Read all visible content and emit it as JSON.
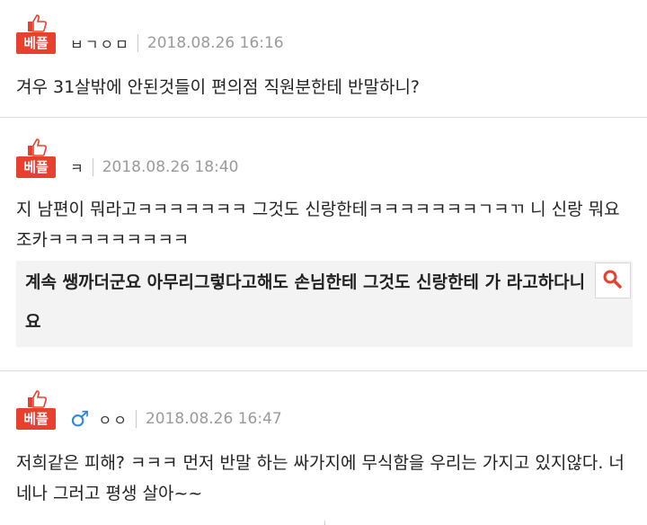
{
  "comments": [
    {
      "badge": "베플",
      "nickname": "ㅂㄱㅇㅁ",
      "date": "2018.08.26 16:16",
      "text": "겨우 31살밖에 안된것들이 편의점 직원분한테 반말하니?"
    },
    {
      "badge": "베플",
      "nickname": "ㅋ",
      "date": "2018.08.26 18:40",
      "text": "지 남편이 뭐라고ㅋㅋㅋㅋㅋㅋㅋ 그것도 신랑한테ㅋㅋㅋㅋㅋㅋㅋㄱㅋㄲ 니 신랑 뭐요 조카ㅋㅋㅋㅋㅋㅋㅋㅋㅋ",
      "quote": "계속 쌩까더군요 아무리그렇다고해도 손님한테 그것도 신랑한테 가 라고하다니요"
    },
    {
      "badge": "베플",
      "gender_icon": "male-icon",
      "gender_symbol": "♂",
      "nickname": "ㅇㅇ",
      "date": "2018.08.26 16:47",
      "text": "저희같은 피해? ㅋㅋㅋ 먼저 반말 하는 싸가지에 무식함을 우리는 가지고 있지않다. 너네나 그러고 평생 살아~~"
    }
  ],
  "colors": {
    "badge": "#e8402f",
    "gender": "#2e86de",
    "search_icon": "#e8402f"
  }
}
